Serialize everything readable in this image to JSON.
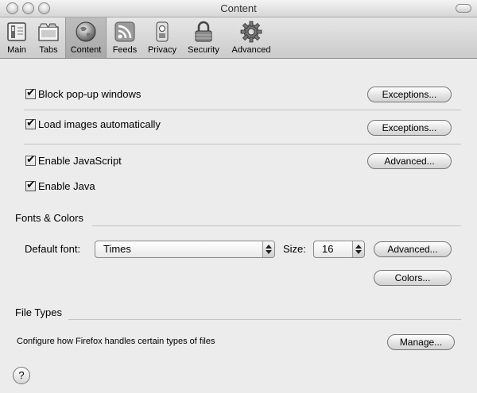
{
  "window": {
    "title": "Content"
  },
  "toolbar": {
    "items": [
      {
        "label": "Main",
        "icon": "switch-icon"
      },
      {
        "label": "Tabs",
        "icon": "tabs-icon"
      },
      {
        "label": "Content",
        "icon": "globe-icon"
      },
      {
        "label": "Feeds",
        "icon": "rss-icon"
      },
      {
        "label": "Privacy",
        "icon": "lock-icon"
      },
      {
        "label": "Security",
        "icon": "padlock-icon"
      },
      {
        "label": "Advanced",
        "icon": "gear-icon"
      }
    ],
    "selected": "Content"
  },
  "content": {
    "popups": {
      "label": "Block pop-up windows",
      "checked": true,
      "button": "Exceptions..."
    },
    "images": {
      "label": "Load images automatically",
      "checked": true,
      "button": "Exceptions..."
    },
    "javascript": {
      "label": "Enable JavaScript",
      "checked": true,
      "button": "Advanced..."
    },
    "java": {
      "label": "Enable Java",
      "checked": true
    }
  },
  "fonts": {
    "heading": "Fonts & Colors",
    "default_font_label": "Default font:",
    "default_font_value": "Times",
    "size_label": "Size:",
    "size_value": "16",
    "advanced_button": "Advanced...",
    "colors_button": "Colors..."
  },
  "filetypes": {
    "heading": "File Types",
    "description": "Configure how Firefox handles certain types of files",
    "manage_button": "Manage..."
  },
  "help": {
    "label": "?"
  }
}
